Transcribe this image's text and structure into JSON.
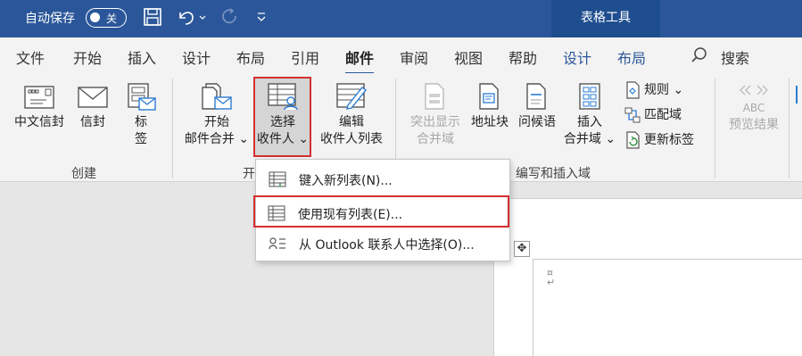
{
  "titlebar": {
    "autosave_label": "自动保存",
    "autosave_state": "关",
    "context_tab_group": "表格工具",
    "colors": {
      "bg": "#2b579a",
      "context": "#1f4e8f"
    }
  },
  "tabs": [
    {
      "label": "文件"
    },
    {
      "label": "开始"
    },
    {
      "label": "插入"
    },
    {
      "label": "设计"
    },
    {
      "label": "布局"
    },
    {
      "label": "引用"
    },
    {
      "label": "邮件"
    },
    {
      "label": "审阅"
    },
    {
      "label": "视图"
    },
    {
      "label": "帮助"
    },
    {
      "label": "设计"
    },
    {
      "label": "布局"
    }
  ],
  "search_label": "搜索",
  "ribbon": {
    "create": {
      "group_label": "创建",
      "chinese_envelope": "中文信封",
      "envelope": "信封",
      "labels_l1": "标",
      "labels_l2": "签"
    },
    "start_merge": {
      "group_label_partial": "开",
      "start_l1": "开始",
      "start_l2": "邮件合并 ⌄",
      "select_l1": "选择",
      "select_l2": "收件人 ⌄",
      "edit_l1": "编辑",
      "edit_l2": "收件人列表"
    },
    "write_insert": {
      "group_label": "编写和插入域",
      "highlight_l1": "突出显示",
      "highlight_l2": "合并域",
      "address_block": "地址块",
      "greeting": "问候语",
      "insert_l1": "插入",
      "insert_l2": "合并域 ⌄",
      "rules": "规则 ⌄",
      "match_fields": "匹配域",
      "update_labels": "更新标签"
    },
    "preview": {
      "abc": "ABC",
      "preview_results": "预览结果"
    }
  },
  "dropdown": {
    "items": [
      {
        "label": "键入新列表(N)..."
      },
      {
        "label": "使用现有列表(E)..."
      },
      {
        "label": "从 Outlook 联系人中选择(O)..."
      }
    ]
  },
  "document": {
    "move_handle": "✥"
  }
}
